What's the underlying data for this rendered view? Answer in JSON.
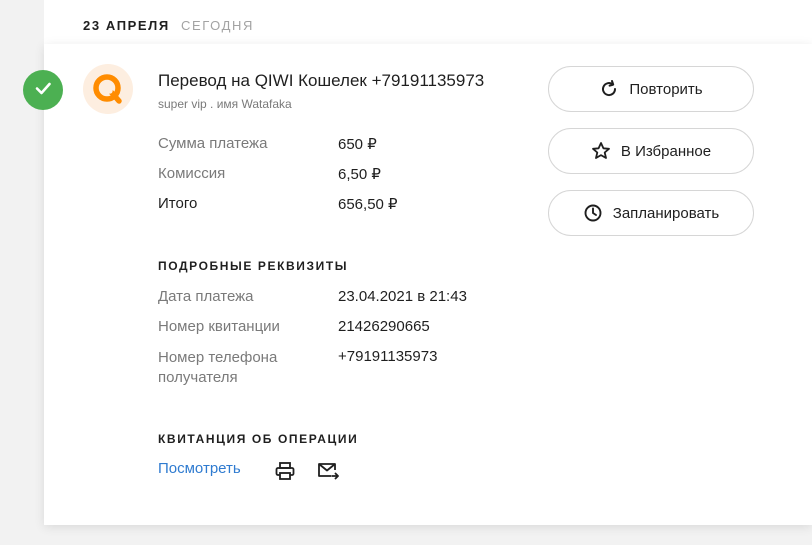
{
  "header": {
    "date": "23 АПРЕЛЯ",
    "relative": "СЕГОДНЯ"
  },
  "payment": {
    "status_icon": "check-icon",
    "provider_logo": "qiwi-logo",
    "title": "Перевод на QIWI Кошелек +79191135973",
    "subtitle": "super vip . имя Watafaka",
    "rows": [
      {
        "label": "Сумма платежа",
        "value": "650 ₽"
      },
      {
        "label": "Комиссия",
        "value": "6,50 ₽"
      },
      {
        "label": "Итого",
        "value": "656,50 ₽"
      }
    ]
  },
  "details": {
    "title": "ПОДРОБНЫЕ РЕКВИЗИТЫ",
    "rows": [
      {
        "label": "Дата платежа",
        "value": "23.04.2021 в 21:43"
      },
      {
        "label": "Номер квитанции",
        "value": "21426290665"
      },
      {
        "label": "Номер телефона получателя",
        "value": "+79191135973"
      }
    ]
  },
  "receipt": {
    "title": "КВИТАНЦИЯ ОБ ОПЕРАЦИИ",
    "view_link": "Посмотреть",
    "print_icon": "printer-icon",
    "email_icon": "mail-forward-icon"
  },
  "actions": [
    {
      "label": "Повторить",
      "icon": "repeat-icon"
    },
    {
      "label": "В Избранное",
      "icon": "star-icon"
    },
    {
      "label": "Запланировать",
      "icon": "clock-icon"
    }
  ],
  "colors": {
    "success": "#4cb052",
    "link": "#2f7bd0",
    "qiwi_orange": "#ff8c00"
  }
}
